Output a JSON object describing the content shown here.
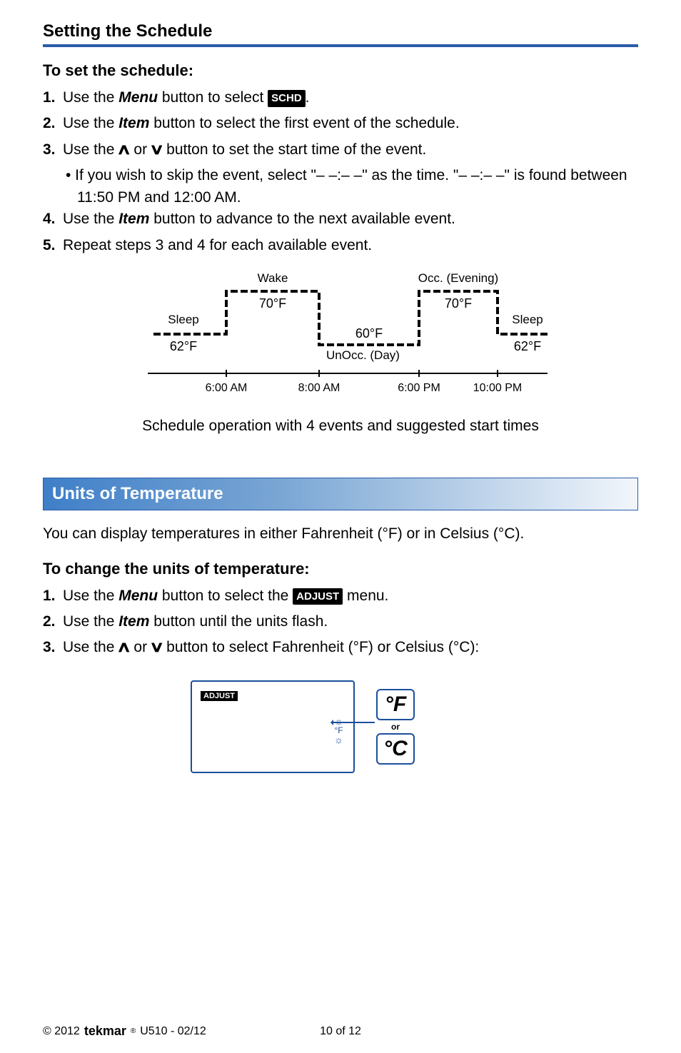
{
  "section1": {
    "title": "Setting the Schedule",
    "sub": "To set the schedule:",
    "s1_a": "Use the ",
    "s1_menu": "Menu",
    "s1_b": " button to select ",
    "s1_pill": "SCHD",
    "s1_c": ".",
    "s2_a": "Use the ",
    "s2_item": "Item",
    "s2_b": " button to select the first event of the schedule.",
    "s3_a": "Use the ",
    "s3_b": " or ",
    "s3_c": " button to set the start time of the event.",
    "s3_bullet": "• If you wish to skip the event, select \"– –:– –\" as the time. \"– –:– –\" is found between 11:50 PM and 12:00 AM.",
    "s4_a": "Use the ",
    "s4_item": "Item",
    "s4_b": " button to advance to the next available event.",
    "s5": "Repeat steps 3 and 4 for each available event."
  },
  "chart_data": {
    "type": "line",
    "title": "Schedule operation with 4 events and suggested start times",
    "x_ticks": [
      "6:00 AM",
      "8:00 AM",
      "6:00 PM",
      "10:00 PM"
    ],
    "events": [
      {
        "name": "Sleep",
        "temp_label": "62°F",
        "temp_f": 62,
        "start": "before 6:00 AM"
      },
      {
        "name": "Wake",
        "temp_label": "70°F",
        "temp_f": 70,
        "start": "6:00 AM"
      },
      {
        "name": "UnOcc. (Day)",
        "temp_label": "60°F",
        "temp_f": 60,
        "start": "8:00 AM"
      },
      {
        "name": "Occ. (Evening)",
        "temp_label": "70°F",
        "temp_f": 70,
        "start": "6:00 PM"
      },
      {
        "name": "Sleep",
        "temp_label": "62°F",
        "temp_f": 62,
        "start": "10:00 PM"
      }
    ]
  },
  "section2": {
    "banner": "Units of Temperature",
    "intro": "You can display temperatures in either Fahrenheit (°F) or in Celsius (°C).",
    "sub": "To change the units of temperature:",
    "s1_a": "Use the ",
    "s1_menu": "Menu",
    "s1_b": " button to select the ",
    "s1_pill": "ADJUST",
    "s1_c": " menu.",
    "s2_a": "Use the ",
    "s2_item": "Item",
    "s2_b": " button until the units flash.",
    "s3_a": "Use the ",
    "s3_b": " or ",
    "s3_c": " button to select Fahrenheit (°F) or Celsius (°C):",
    "lcd_pill": "ADJUST",
    "lcd_f": "°F",
    "deg_f": "°F",
    "deg_c": "°C",
    "or": "or"
  },
  "footer": {
    "copyright": "© 2012 ",
    "brand": "tekmar",
    "reg": "®",
    "doc": " U510 - 02/12",
    "page": "10 of 12"
  }
}
